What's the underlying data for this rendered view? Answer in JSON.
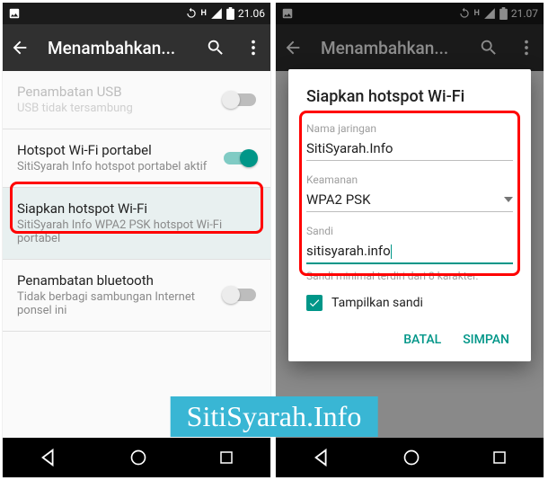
{
  "status": {
    "time_left": "21.06",
    "time_right": "21.07"
  },
  "appbar": {
    "title": "Menambahkan..."
  },
  "rows": {
    "usb": {
      "t1": "Penambatan USB",
      "t2": "USB tidak tersambung"
    },
    "hotspot": {
      "t1": "Hotspot Wi-Fi portabel",
      "t2": "SitiSyarah Info hotspot portabel aktif"
    },
    "setup": {
      "t1": "Siapkan hotspot Wi-Fi",
      "t2": "SitiSyarah Info WPA2 PSK hotspot Wi-Fi portabel"
    },
    "bt": {
      "t1": "Penambatan bluetooth",
      "t2": "Tidak berbagi sambungan Internet ponsel ini"
    }
  },
  "dialog": {
    "title": "Siapkan hotspot Wi-Fi",
    "name_label": "Nama jaringan",
    "name_value": "SitiSyarah.Info",
    "sec_label": "Keamanan",
    "sec_value": "WPA2 PSK",
    "pwd_label": "Sandi",
    "pwd_value": "sitisyarah.info",
    "hint": "Sandi minimal terdiri dari 8 karakter.",
    "show_pwd": "Tampilkan sandi",
    "cancel": "BATAL",
    "save": "SIMPAN"
  },
  "watermark": "SitiSyarah.Info"
}
